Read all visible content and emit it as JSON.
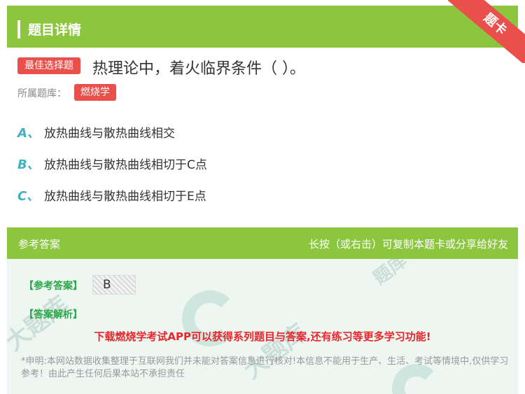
{
  "header": {
    "title": "题目详情"
  },
  "ribbon": {
    "label": "题卡"
  },
  "question": {
    "tag": "最佳选择题",
    "text": "热理论中，着火临界条件（ ）。",
    "bank_label": "所属题库：",
    "bank_tag": "燃烧学"
  },
  "options": [
    {
      "letter": "A、",
      "text": "放热曲线与散热曲线相交"
    },
    {
      "letter": "B、",
      "text": "放热曲线与散热曲线相切于C点"
    },
    {
      "letter": "C、",
      "text": "放热曲线与散热曲线相切于E点"
    }
  ],
  "answer_panel": {
    "title": "参考答案",
    "hint": "长按（或右击）可复制本题卡或分享给好友",
    "ref_label": "【参考答案】",
    "ref_value": "B",
    "analysis_label": "【答案解析】",
    "promo": "下载燃烧学考试APP可以获得系列题目与答案,还有练习等更多学习功能!",
    "disclaimer": "*申明:本网站数据收集整理于互联网我们并未能对答案信息进行核对!本信息不能用于生产、生活、考试等情境中,仅供学习参考！由此产生任何后果本站不承担责任"
  },
  "colors": {
    "green": "#8cc63f",
    "red": "#e9504b",
    "teal": "#3fb2c3"
  }
}
